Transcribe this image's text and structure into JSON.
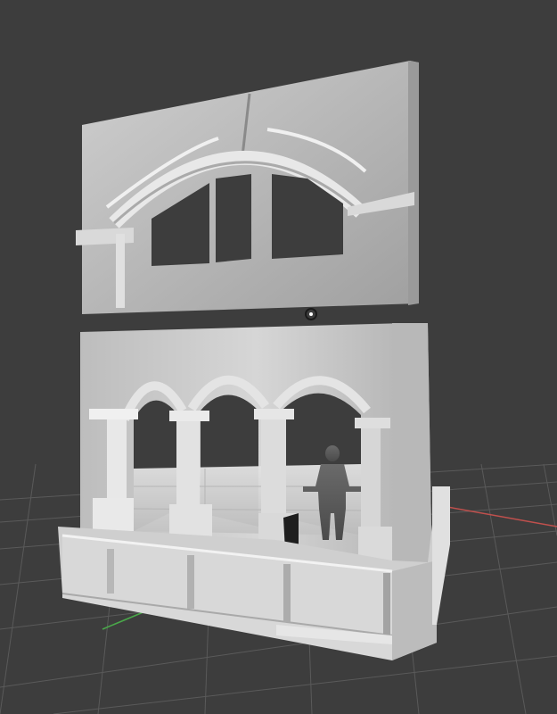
{
  "viewport": {
    "background_color": "#3d3d3d",
    "grid_color": "#5a5a5a",
    "x_axis_color": "#c0504d",
    "y_axis_color": "#4aa84a",
    "model_color": "#c8c8c8",
    "shadow_color": "#2a2a2a"
  },
  "scene": {
    "objects": [
      "building-upper-facade",
      "building-lower-arcade",
      "building-base",
      "human-figure",
      "light-gizmo"
    ]
  }
}
